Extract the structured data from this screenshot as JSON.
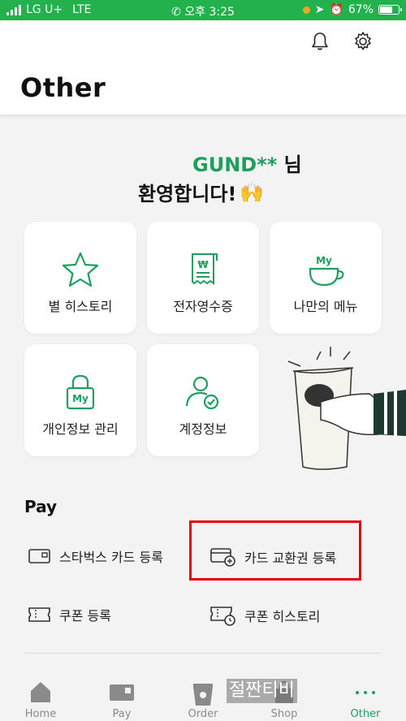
{
  "status_bar": {
    "carrier": "LG U+",
    "network": "LTE",
    "time": "오후 3:25",
    "battery": "67%"
  },
  "header": {
    "title": "Other"
  },
  "welcome": {
    "name": "GUND**",
    "suffix": " 님",
    "greeting": "환영합니다!",
    "emoji": "🙌"
  },
  "tiles": [
    {
      "label": "별 히스토리",
      "icon": "star-icon"
    },
    {
      "label": "전자영수증",
      "icon": "receipt-icon"
    },
    {
      "label": "나만의 메뉴",
      "icon": "my-cup-icon",
      "badge": "My"
    },
    {
      "label": "개인정보 관리",
      "icon": "lock-icon",
      "badge": "My"
    },
    {
      "label": "계정정보",
      "icon": "account-check-icon"
    }
  ],
  "pay": {
    "title": "Pay",
    "items": [
      {
        "label": "스타벅스 카드 등록",
        "icon": "card-icon"
      },
      {
        "label": "카드 교환권 등록",
        "icon": "card-add-icon"
      },
      {
        "label": "쿠폰 등록",
        "icon": "coupon-icon"
      },
      {
        "label": "쿠폰 히스토리",
        "icon": "coupon-history-icon"
      }
    ]
  },
  "tabbar": {
    "tabs": [
      {
        "label": "Home",
        "icon": "home-icon"
      },
      {
        "label": "Pay",
        "icon": "pay-card-icon"
      },
      {
        "label": "Order",
        "icon": "cup-icon"
      },
      {
        "label": "Shop",
        "icon": "shop-icon"
      },
      {
        "label": "Other",
        "icon": "more-dots-icon",
        "active": true
      }
    ]
  },
  "watermark": "절짠티비",
  "colors": {
    "status_bar": "#22b14c",
    "accent": "#1f9e5f",
    "highlight": "#e00000"
  }
}
